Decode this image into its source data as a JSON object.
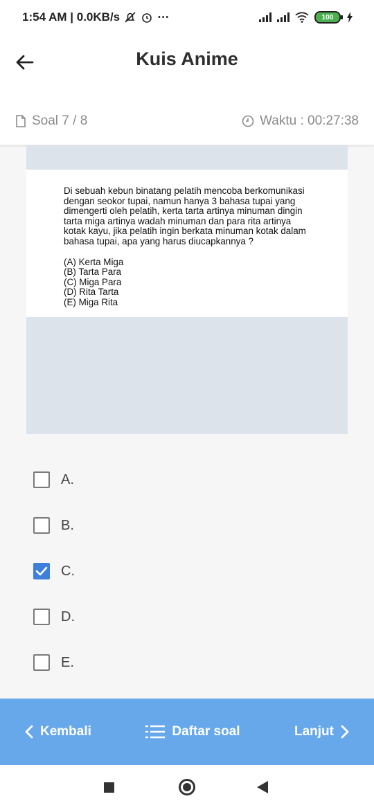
{
  "status_bar": {
    "time": "1:54 AM | 0.0KB/s",
    "extra_icons": "⋯",
    "battery": "100"
  },
  "app_bar": {
    "title": "Kuis Anime"
  },
  "info_bar": {
    "question_counter": "Soal 7 / 8",
    "timer": "Waktu : 00:27:38"
  },
  "question": {
    "text_lines": [
      "Di sebuah kebun binatang pelatih mencoba berkomunikasi",
      "dengan seokor tupai, namun hanya 3 bahasa tupai yang",
      "dimengerti oleh pelatih, kerta tarta artinya minuman dingin",
      "tarta miga artinya wadah minuman dan para rita artinya",
      "kotak kayu, jika pelatih ingin berkata minuman kotak dalam",
      "bahasa tupai, apa yang harus diucapkannya ?"
    ],
    "choices": [
      "(A) Kerta Miga",
      "(B) Tarta Para",
      "(C) Miga Para",
      "(D) Rita Tarta",
      "(E) Miga Rita"
    ]
  },
  "answers": [
    {
      "label": "A.",
      "checked": false
    },
    {
      "label": "B.",
      "checked": false
    },
    {
      "label": "C.",
      "checked": true
    },
    {
      "label": "D.",
      "checked": false
    },
    {
      "label": "E.",
      "checked": false
    }
  ],
  "bottom_bar": {
    "back_label": "Kembali",
    "list_label": "Daftar soal",
    "next_label": "Lanjut"
  },
  "colors": {
    "accent": "#67a8ea",
    "checkbox_checked": "#3d7fd9",
    "question_bg": "#dde3eb"
  },
  "icons": {
    "back": "arrow-left-icon",
    "page": "document-icon",
    "clock": "clock-icon",
    "prev": "chevron-left-icon",
    "list": "list-icon",
    "next": "chevron-right-icon"
  }
}
